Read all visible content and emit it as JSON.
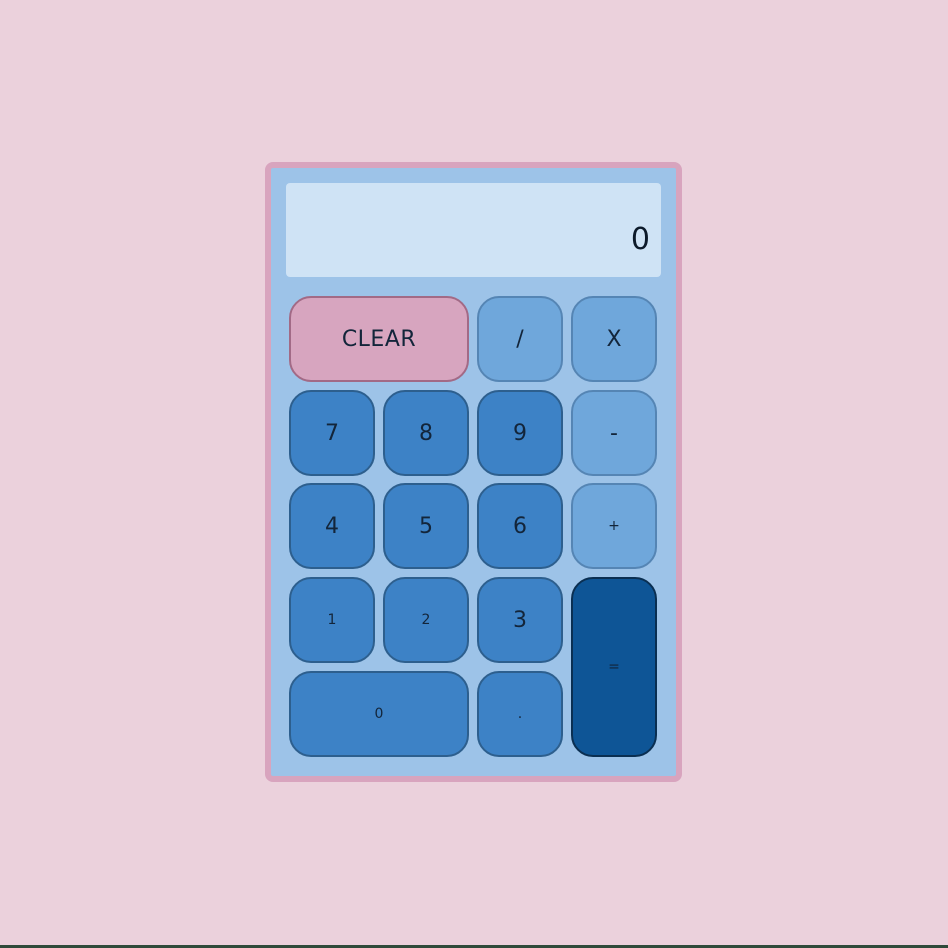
{
  "display": {
    "value": "0"
  },
  "keys": {
    "clear": "CLEAR",
    "divide": "/",
    "multiply": "X",
    "seven": "7",
    "eight": "8",
    "nine": "9",
    "minus": "-",
    "four": "4",
    "five": "5",
    "six": "6",
    "plus": "+",
    "one": "1",
    "two": "2",
    "three": "3",
    "equals": "=",
    "zero": "0",
    "decimal": "."
  },
  "colors": {
    "page_background": "#ebd1dc",
    "calculator_body": "#9dc3e8",
    "calculator_border": "#d8a4be",
    "display_background": "#cfe3f5",
    "number_key": "#3d82c6",
    "operator_key": "#6fa7db",
    "clear_key": "#d7a5bf",
    "equals_key": "#0e5596"
  }
}
